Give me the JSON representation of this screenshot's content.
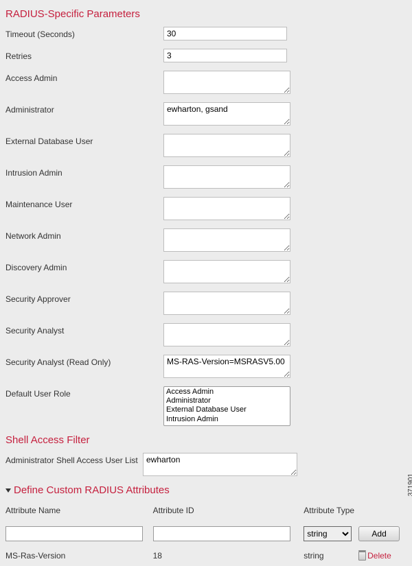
{
  "sections": {
    "radius_title": "RADIUS-Specific Parameters",
    "shell_title": "Shell Access Filter",
    "custom_title": "Define Custom RADIUS Attributes"
  },
  "fields": {
    "timeout_label": "Timeout (Seconds)",
    "timeout_value": "30",
    "retries_label": "Retries",
    "retries_value": "3",
    "access_admin_label": "Access Admin",
    "access_admin_value": "",
    "administrator_label": "Administrator",
    "administrator_value": "ewharton, gsand",
    "ext_db_user_label": "External Database User",
    "ext_db_user_value": "",
    "intrusion_admin_label": "Intrusion Admin",
    "intrusion_admin_value": "",
    "maint_user_label": "Maintenance User",
    "maint_user_value": "",
    "network_admin_label": "Network Admin",
    "network_admin_value": "",
    "discovery_admin_label": "Discovery Admin",
    "discovery_admin_value": "",
    "sec_approver_label": "Security Approver",
    "sec_approver_value": "",
    "sec_analyst_label": "Security Analyst",
    "sec_analyst_value": "",
    "sec_analyst_ro_label": "Security Analyst (Read Only)",
    "sec_analyst_ro_value": "MS-RAS-Version=MSRASV5.00",
    "default_role_label": "Default User Role",
    "shell_user_label": "Administrator Shell Access User List",
    "shell_user_value": "ewharton"
  },
  "default_role_options": {
    "o0": "Access Admin",
    "o1": "Administrator",
    "o2": "External Database User",
    "o3": "Intrusion Admin"
  },
  "attr_headers": {
    "name": "Attribute Name",
    "id": "Attribute ID",
    "type": "Attribute Type"
  },
  "attr_type_options": {
    "s0": "string"
  },
  "add_label": "Add",
  "delete_label": "Delete",
  "attr_row": {
    "name": "MS-Ras-Version",
    "id": "18",
    "type": "string"
  },
  "side_id": "371901"
}
